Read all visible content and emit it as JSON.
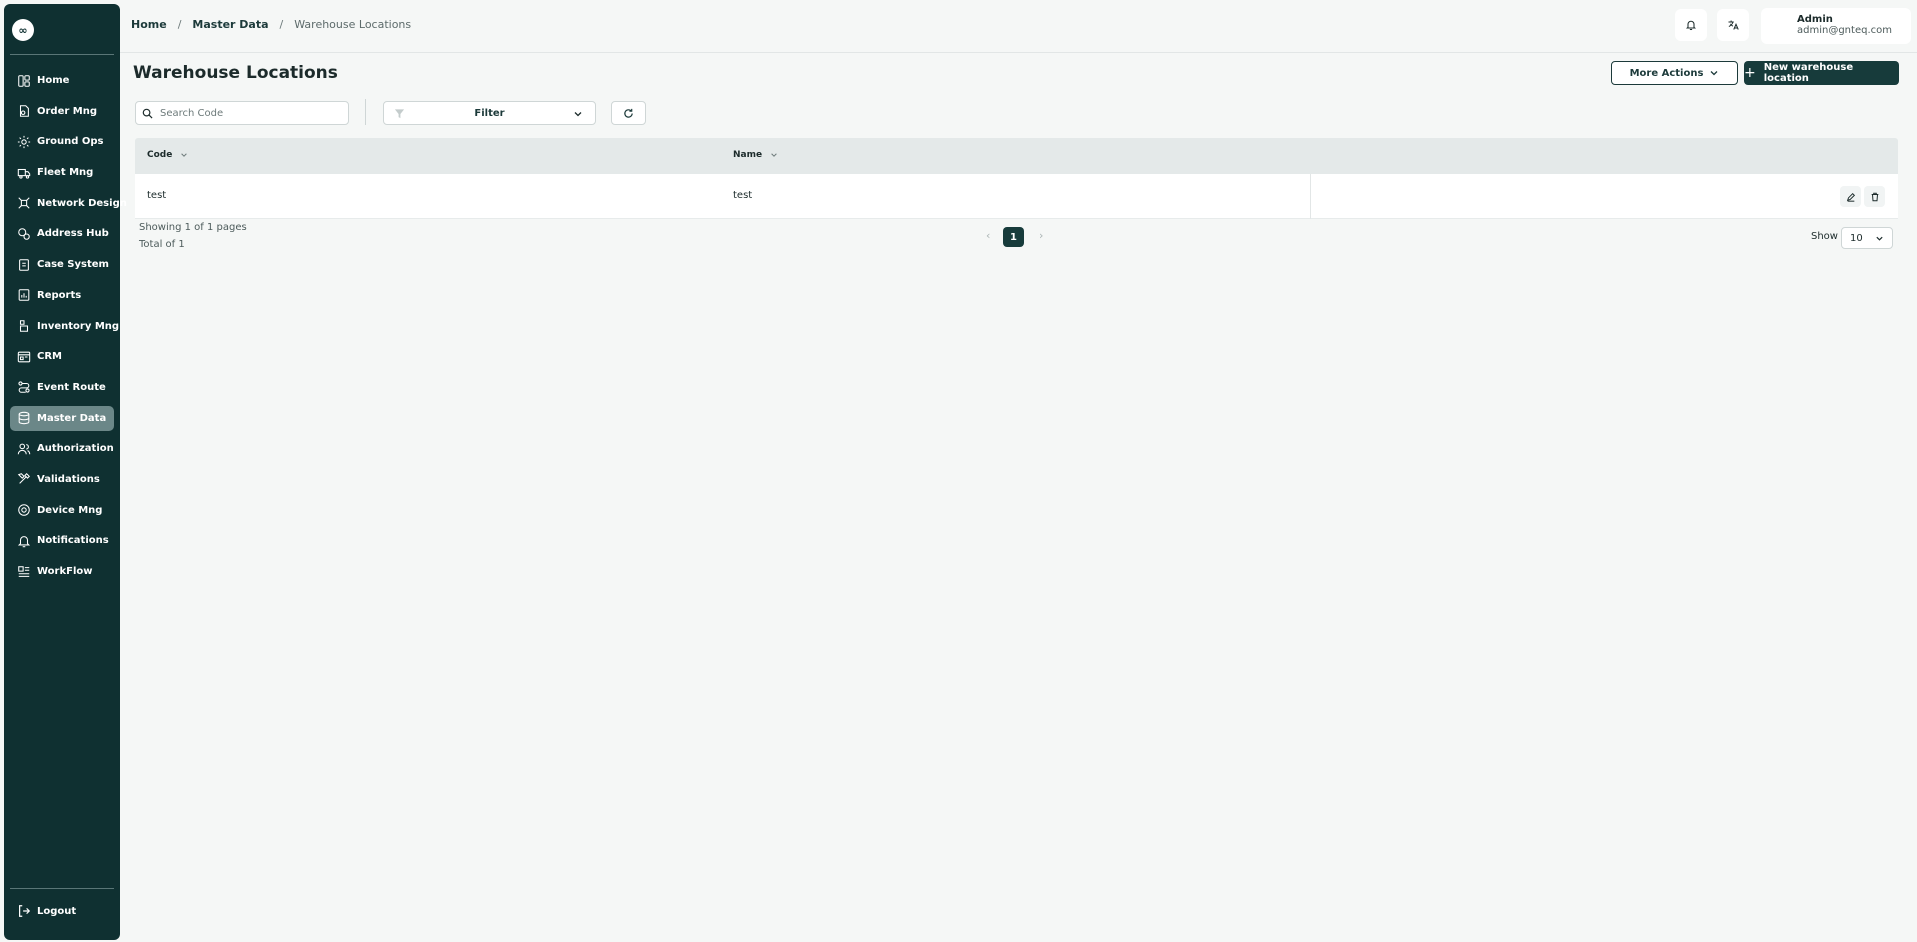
{
  "app": {
    "logo_text": "∞"
  },
  "sidebar": {
    "items": [
      {
        "label": "Home",
        "icon": "home-icon"
      },
      {
        "label": "Order Mng",
        "icon": "order-icon"
      },
      {
        "label": "Ground Ops",
        "icon": "ground-ops-icon"
      },
      {
        "label": "Fleet Mng",
        "icon": "truck-icon"
      },
      {
        "label": "Network Design",
        "icon": "network-icon"
      },
      {
        "label": "Address Hub",
        "icon": "address-icon"
      },
      {
        "label": "Case System",
        "icon": "case-icon"
      },
      {
        "label": "Reports",
        "icon": "reports-icon"
      },
      {
        "label": "Inventory Mng",
        "icon": "inventory-icon"
      },
      {
        "label": "CRM",
        "icon": "crm-icon"
      },
      {
        "label": "Event Route",
        "icon": "route-icon"
      },
      {
        "label": "Master Data",
        "icon": "database-icon",
        "active": true
      },
      {
        "label": "Authorization",
        "icon": "users-icon"
      },
      {
        "label": "Validations",
        "icon": "tools-icon"
      },
      {
        "label": "Device Mng",
        "icon": "device-icon"
      },
      {
        "label": "Notifications",
        "icon": "bell-icon"
      },
      {
        "label": "WorkFlow",
        "icon": "workflow-icon"
      }
    ],
    "logout_label": "Logout"
  },
  "header": {
    "breadcrumb": [
      "Home",
      "Master Data",
      "Warehouse Locations"
    ],
    "user": {
      "name": "Admin",
      "email": "admin@gnteq.com"
    }
  },
  "page": {
    "title": "Warehouse Locations",
    "more_actions_label": "More Actions",
    "new_button_label": "New warehouse location",
    "search_placeholder": "Search Code",
    "filter_label": "Filter"
  },
  "table": {
    "columns": [
      "Code",
      "Name"
    ],
    "rows": [
      {
        "code": "test",
        "name": "test"
      }
    ]
  },
  "pagination": {
    "showing_text": "Showing 1 of 1 pages",
    "total_text": "Total of 1",
    "current_page": "1",
    "show_label": "Show",
    "page_size": "10"
  }
}
